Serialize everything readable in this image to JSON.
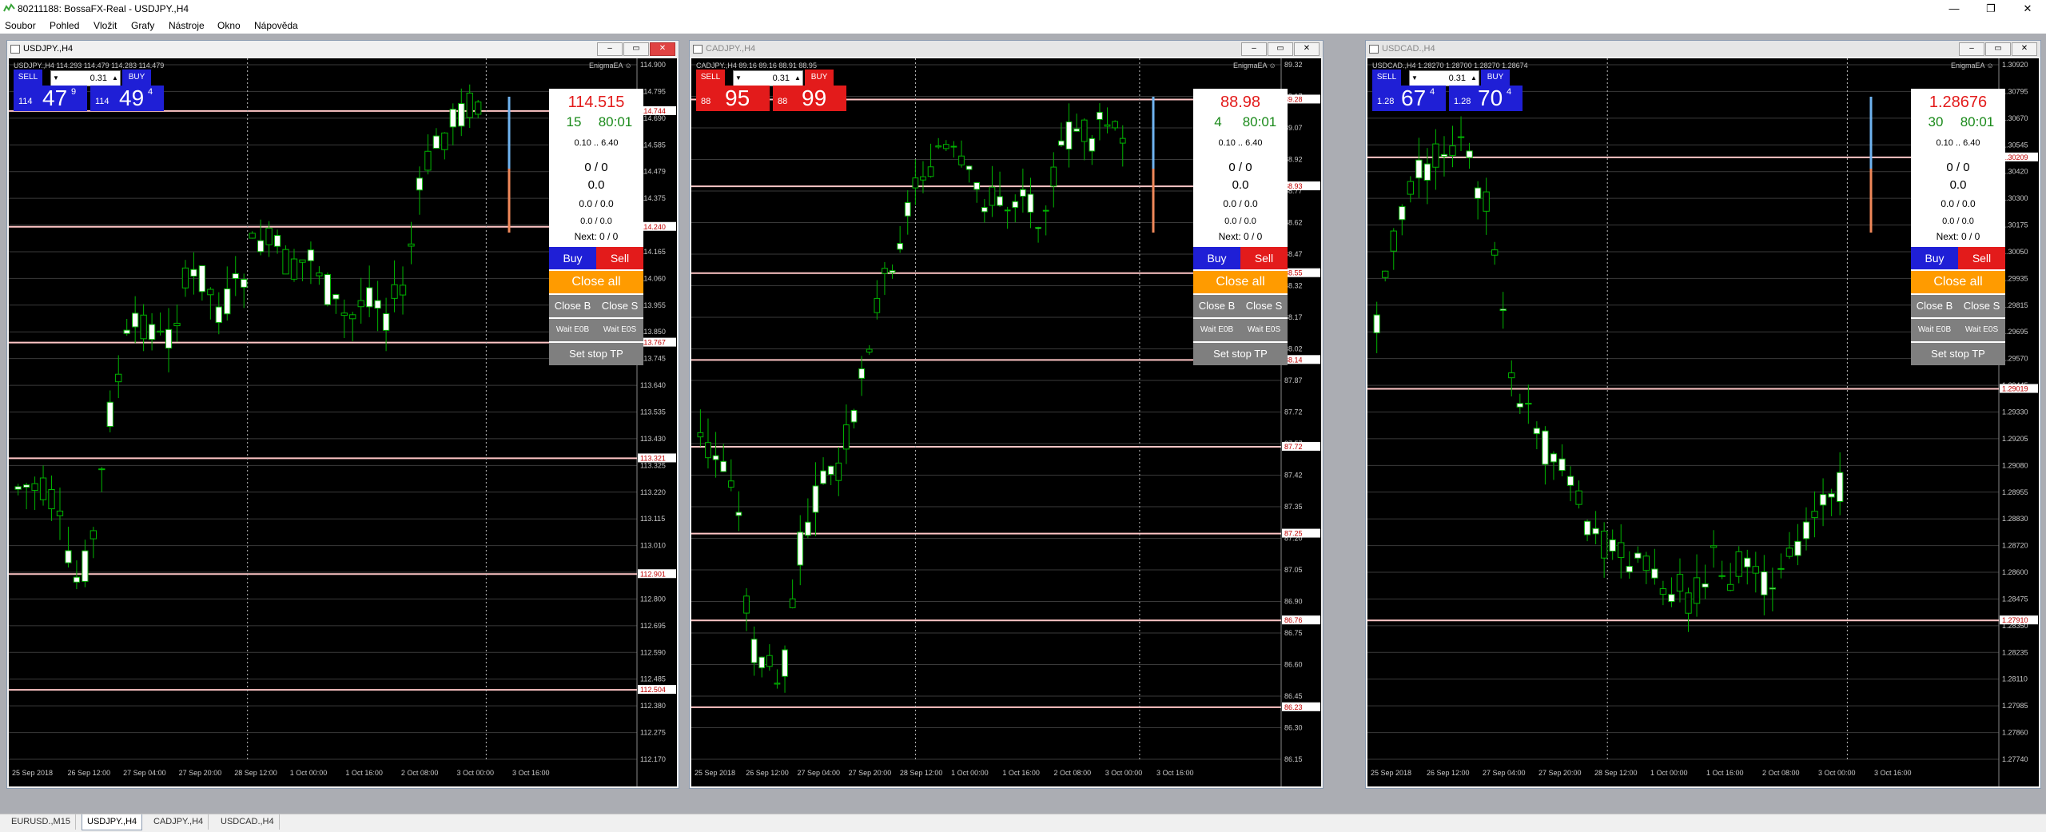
{
  "titlebar": {
    "title": "80211188: BossaFX-Real - USDJPY.,H4",
    "min": "—",
    "max": "❐",
    "close": "✕"
  },
  "menu": [
    "Soubor",
    "Pohled",
    "Vložit",
    "Grafy",
    "Nástroje",
    "Okno",
    "Nápověda"
  ],
  "charts": [
    {
      "title": "USDJPY.,H4",
      "header": "USDJPY.,H4  114.293 114.479 114.283 114.479",
      "ea": "EnigmaEA ☺",
      "theme": "blue",
      "sell_label": "SELL",
      "buy_label": "BUY",
      "lot": "0.31",
      "bid_small": "114",
      "bid_big": "47",
      "bid_sup": "9",
      "ask_small": "114",
      "ask_big": "49",
      "ask_sup": "4",
      "panel": {
        "price": "114.515",
        "count": "15",
        "time": "80:01",
        "range": "0.10 .. 6.40",
        "l1": "0 / 0",
        "l2": "0.0",
        "l3": "0.0 / 0.0",
        "l4": "0.0 / 0.0",
        "next": "Next: 0 / 0",
        "buy": "Buy",
        "sell": "Sell",
        "close_all": "Close all",
        "close_b": "Close B",
        "close_s": "Close S",
        "wait_eob": "Wait E0B",
        "wait_eos": "Wait E0S",
        "set_stop": "Set stop TP"
      },
      "price_labels": [
        "114.900",
        "114.795",
        "114.690",
        "114.585",
        "114.479",
        "114.375",
        "114.270",
        "114.165",
        "114.060",
        "113.955",
        "113.850",
        "113.745",
        "113.640",
        "113.535",
        "113.430",
        "113.325",
        "113.220",
        "113.115",
        "113.010",
        "112.905",
        "112.800",
        "112.695",
        "112.590",
        "112.485",
        "112.380",
        "112.275",
        "112.170"
      ],
      "highlight_prices": [
        "114.744",
        "114.240",
        "113.767",
        "113.321",
        "112.901",
        "112.504"
      ],
      "time_labels": [
        "25 Sep 2018",
        "26 Sep 12:00",
        "27 Sep 04:00",
        "27 Sep 20:00",
        "28 Sep 12:00",
        "1 Oct 00:00",
        "1 Oct 16:00",
        "2 Oct 08:00",
        "3 Oct 00:00",
        "3 Oct 16:00"
      ]
    },
    {
      "title": "CADJPY.,H4",
      "header": "CADJPY.,H4  89.16 89.16 88.91 88.95",
      "ea": "EnigmaEA ☺",
      "theme": "red",
      "sell_label": "SELL",
      "buy_label": "BUY",
      "lot": "0.31",
      "bid_small": "88",
      "bid_big": "95",
      "bid_sup": "",
      "ask_small": "88",
      "ask_big": "99",
      "ask_sup": "",
      "panel": {
        "price": "88.98",
        "count": "4",
        "time": "80:01",
        "range": "0.10 .. 6.40",
        "l1": "0 / 0",
        "l2": "0.0",
        "l3": "0.0 / 0.0",
        "l4": "0.0 / 0.0",
        "next": "Next: 0 / 0",
        "buy": "Buy",
        "sell": "Sell",
        "close_all": "Close all",
        "close_b": "Close B",
        "close_s": "Close S",
        "wait_eob": "Wait E0B",
        "wait_eos": "Wait E0S",
        "set_stop": "Set stop TP"
      },
      "price_labels": [
        "89.32",
        "89.17",
        "89.07",
        "88.92",
        "88.77",
        "88.62",
        "88.47",
        "88.32",
        "88.17",
        "88.02",
        "87.87",
        "87.72",
        "87.57",
        "87.42",
        "87.35",
        "87.20",
        "87.05",
        "86.90",
        "86.75",
        "86.60",
        "86.45",
        "86.30",
        "86.15"
      ],
      "highlight_prices": [
        "89.28",
        "88.93",
        "88.55",
        "88.14",
        "87.72",
        "87.25",
        "86.76",
        "86.23"
      ],
      "time_labels": [
        "25 Sep 2018",
        "26 Sep 12:00",
        "27 Sep 04:00",
        "27 Sep 20:00",
        "28 Sep 12:00",
        "1 Oct 00:00",
        "1 Oct 16:00",
        "2 Oct 08:00",
        "3 Oct 00:00",
        "3 Oct 16:00"
      ]
    },
    {
      "title": "USDCAD.,H4",
      "header": "USDCAD.,H4  1.28270 1.28700 1.28270 1.28674",
      "ea": "EnigmaEA ☺",
      "theme": "blue",
      "sell_label": "SELL",
      "buy_label": "BUY",
      "lot": "0.31",
      "bid_small": "1.28",
      "bid_big": "67",
      "bid_sup": "4",
      "ask_small": "1.28",
      "ask_big": "70",
      "ask_sup": "4",
      "panel": {
        "price": "1.28676",
        "count": "30",
        "time": "80:01",
        "range": "0.10 .. 6.40",
        "l1": "0 / 0",
        "l2": "0.0",
        "l3": "0.0 / 0.0",
        "l4": "0.0 / 0.0",
        "next": "Next: 0 / 0",
        "buy": "Buy",
        "sell": "Sell",
        "close_all": "Close all",
        "close_b": "Close B",
        "close_s": "Close S",
        "wait_eob": "Wait E0B",
        "wait_eos": "Wait E0S",
        "set_stop": "Set stop TP"
      },
      "price_labels": [
        "1.30920",
        "1.30795",
        "1.30670",
        "1.30545",
        "1.30420",
        "1.30300",
        "1.30175",
        "1.30050",
        "1.29935",
        "1.29815",
        "1.29695",
        "1.29570",
        "1.29445",
        "1.29330",
        "1.29205",
        "1.29080",
        "1.28955",
        "1.28830",
        "1.28720",
        "1.28600",
        "1.28475",
        "1.28350",
        "1.28235",
        "1.28110",
        "1.27985",
        "1.27860",
        "1.27740"
      ],
      "highlight_prices": [
        "1.30209",
        "1.29019",
        "1.27910"
      ],
      "time_labels": [
        "25 Sep 2018",
        "26 Sep 12:00",
        "27 Sep 04:00",
        "27 Sep 20:00",
        "28 Sep 12:00",
        "1 Oct 00:00",
        "1 Oct 16:00",
        "2 Oct 08:00",
        "3 Oct 00:00",
        "3 Oct 16:00"
      ]
    }
  ],
  "tabs": [
    "EURUSD.,M15",
    "USDJPY.,H4",
    "CADJPY.,H4",
    "USDCAD.,H4"
  ],
  "active_tab": 1,
  "colors": {
    "blue_btn": "#1f1fd6",
    "red_btn": "#e31b1b",
    "orange": "#ff9b00",
    "bull": "#00b400",
    "bear": "#ffffff",
    "level": "#ffc6c6",
    "grid": "#3a3a3a"
  }
}
